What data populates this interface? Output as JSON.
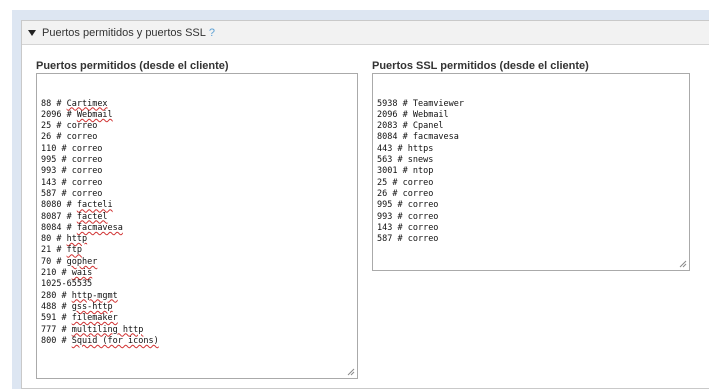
{
  "section": {
    "title": "Puertos permitidos y puertos SSL",
    "help": "?"
  },
  "allowed": {
    "label": "Puertos permitidos (desde el cliente)",
    "lines": [
      {
        "port": "88",
        "name": "Cartimex",
        "sq": true
      },
      {
        "port": "2096",
        "name": "Webmail",
        "sq": true
      },
      {
        "port": "25",
        "name": "correo",
        "sq": false
      },
      {
        "port": "26",
        "name": "correo",
        "sq": false
      },
      {
        "port": "110",
        "name": "correo",
        "sq": false
      },
      {
        "port": "995",
        "name": "correo",
        "sq": false
      },
      {
        "port": "993",
        "name": "correo",
        "sq": false
      },
      {
        "port": "143",
        "name": "correo",
        "sq": false
      },
      {
        "port": "587",
        "name": "correo",
        "sq": false
      },
      {
        "port": "8080",
        "name": "facteli",
        "sq": true
      },
      {
        "port": "8087",
        "name": "factel",
        "sq": true
      },
      {
        "port": "8084",
        "name": "facmavesa",
        "sq": true
      },
      {
        "port": "80",
        "name": "http",
        "sq": true
      },
      {
        "port": "21",
        "name": "ftp",
        "sq": true
      },
      {
        "port": "70",
        "name": "gopher",
        "sq": true
      },
      {
        "port": "210",
        "name": "wais",
        "sq": true
      },
      {
        "port": "1025-65535",
        "name": "",
        "sq": false
      },
      {
        "port": "280",
        "name": "http-mgmt",
        "sq": true
      },
      {
        "port": "488",
        "name": "gss-http",
        "sq": true
      },
      {
        "port": "591",
        "name": "filemaker",
        "sq": true
      },
      {
        "port": "777",
        "name": "multiling http",
        "sq": true
      },
      {
        "port": "800",
        "name": "Squid (for icons)",
        "sq": true
      }
    ]
  },
  "ssl": {
    "label": "Puertos SSL permitidos (desde el cliente)",
    "lines": [
      {
        "port": "5938",
        "name": "Teamviewer",
        "sq": false
      },
      {
        "port": "2096",
        "name": "Webmail",
        "sq": false
      },
      {
        "port": "2083",
        "name": "Cpanel",
        "sq": false
      },
      {
        "port": "8084",
        "name": "facmavesa",
        "sq": false
      },
      {
        "port": "443",
        "name": "https",
        "sq": false
      },
      {
        "port": "563",
        "name": "snews",
        "sq": false
      },
      {
        "port": "3001",
        "name": "ntop",
        "sq": false
      },
      {
        "port": "25",
        "name": "correo",
        "sq": false
      },
      {
        "port": "26",
        "name": "correo",
        "sq": false
      },
      {
        "port": "995",
        "name": "correo",
        "sq": false
      },
      {
        "port": "993",
        "name": "correo",
        "sq": false
      },
      {
        "port": "143",
        "name": "correo",
        "sq": false
      },
      {
        "port": "587",
        "name": "correo",
        "sq": false
      }
    ]
  },
  "colors": {
    "outer_bg": "#dde6f2",
    "header_bg": "#f2f2f2",
    "help": "#5a9fd4",
    "spellcheck": "#d03030"
  }
}
